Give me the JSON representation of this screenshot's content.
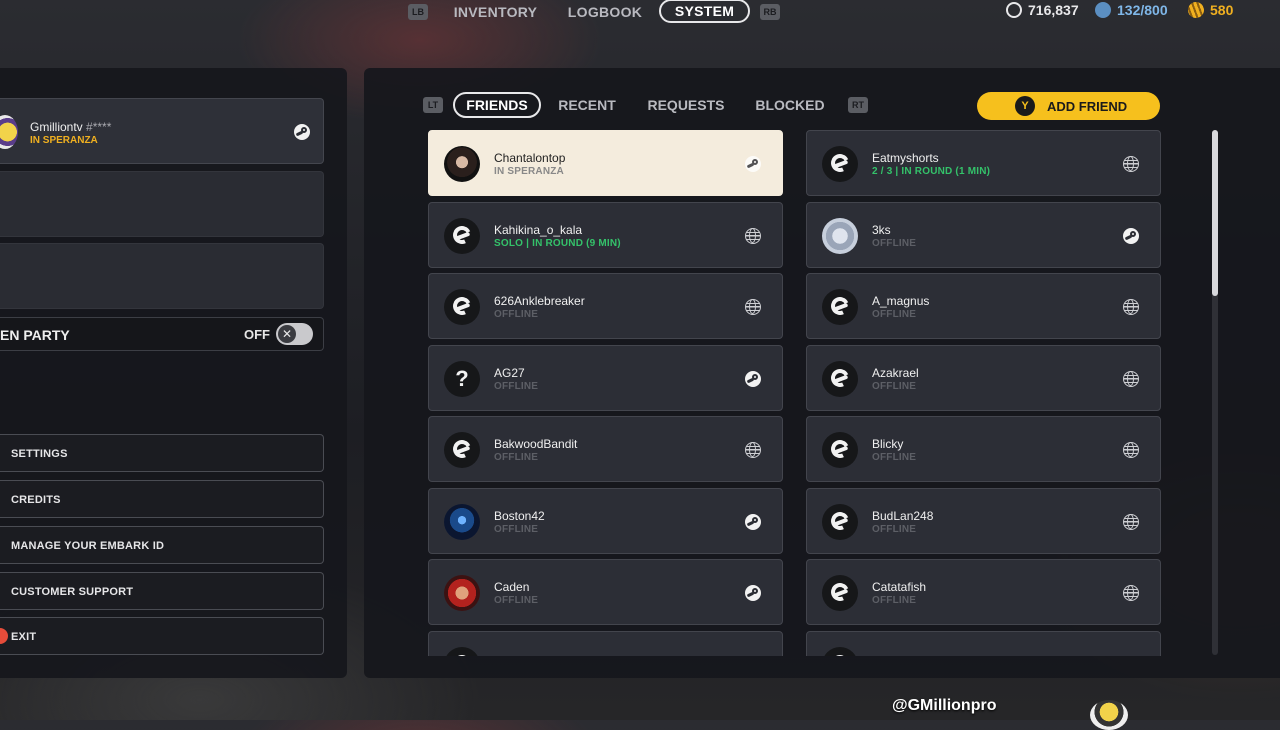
{
  "topnav": {
    "lb": "LB",
    "rb": "RB",
    "tabs": [
      "INVENTORY",
      "LOGBOOK",
      "SYSTEM"
    ],
    "active_tab": "SYSTEM",
    "currencies": [
      {
        "icon": "coin-icon",
        "value": "716,837",
        "color": "#e8e8ea"
      },
      {
        "icon": "e-token-icon",
        "value": "132/800",
        "color": "#7fb7e8"
      },
      {
        "icon": "multibucks-icon",
        "value": "580",
        "color": "#f0b020"
      }
    ]
  },
  "party": {
    "self_name": "Gmilliontv",
    "self_tag": "#****",
    "self_status": "IN SPERANZA",
    "open_party_label": "EN PARTY",
    "open_party_state": "OFF",
    "toggle_symbol": "✕"
  },
  "menu": {
    "settings": "SETTINGS",
    "credits": "CREDITS",
    "manage_id": "MANAGE YOUR EMBARK ID",
    "support": "CUSTOMER SUPPORT",
    "exit": "EXIT"
  },
  "friends_tabs": {
    "lt": "LT",
    "rt": "RT",
    "friends": "FRIENDS",
    "recent": "RECENT",
    "requests": "REQUESTS",
    "blocked": "BLOCKED",
    "add_friend": "ADD FRIEND",
    "y": "Y"
  },
  "friends_left": [
    {
      "name": "Chantalontop",
      "status": "IN SPERANZA",
      "platform": "steam"
    },
    {
      "name": "Kahikina_o_kala",
      "status": "SOLO | IN ROUND (9 MIN)",
      "platform": "globe"
    },
    {
      "name": "626Anklebreaker",
      "status": "OFFLINE",
      "platform": "globe"
    },
    {
      "name": "AG27",
      "status": "OFFLINE",
      "platform": "steam"
    },
    {
      "name": "BakwoodBandit",
      "status": "OFFLINE",
      "platform": "globe"
    },
    {
      "name": "Boston42",
      "status": "OFFLINE",
      "platform": "steam"
    },
    {
      "name": "Caden",
      "status": "OFFLINE",
      "platform": "steam"
    }
  ],
  "friends_right": [
    {
      "name": "Eatmyshorts",
      "status": "2 / 3 | IN ROUND (1 MIN)",
      "platform": "globe"
    },
    {
      "name": "3ks",
      "status": "OFFLINE",
      "platform": "steam"
    },
    {
      "name": "A_magnus",
      "status": "OFFLINE",
      "platform": "globe"
    },
    {
      "name": "Azakrael",
      "status": "OFFLINE",
      "platform": "globe"
    },
    {
      "name": "Blicky",
      "status": "OFFLINE",
      "platform": "globe"
    },
    {
      "name": "BudLan248",
      "status": "OFFLINE",
      "platform": "globe"
    },
    {
      "name": "Catatafish",
      "status": "OFFLINE",
      "platform": "globe"
    }
  ],
  "avatar_question": "?",
  "watermark": "@GMillionpro"
}
